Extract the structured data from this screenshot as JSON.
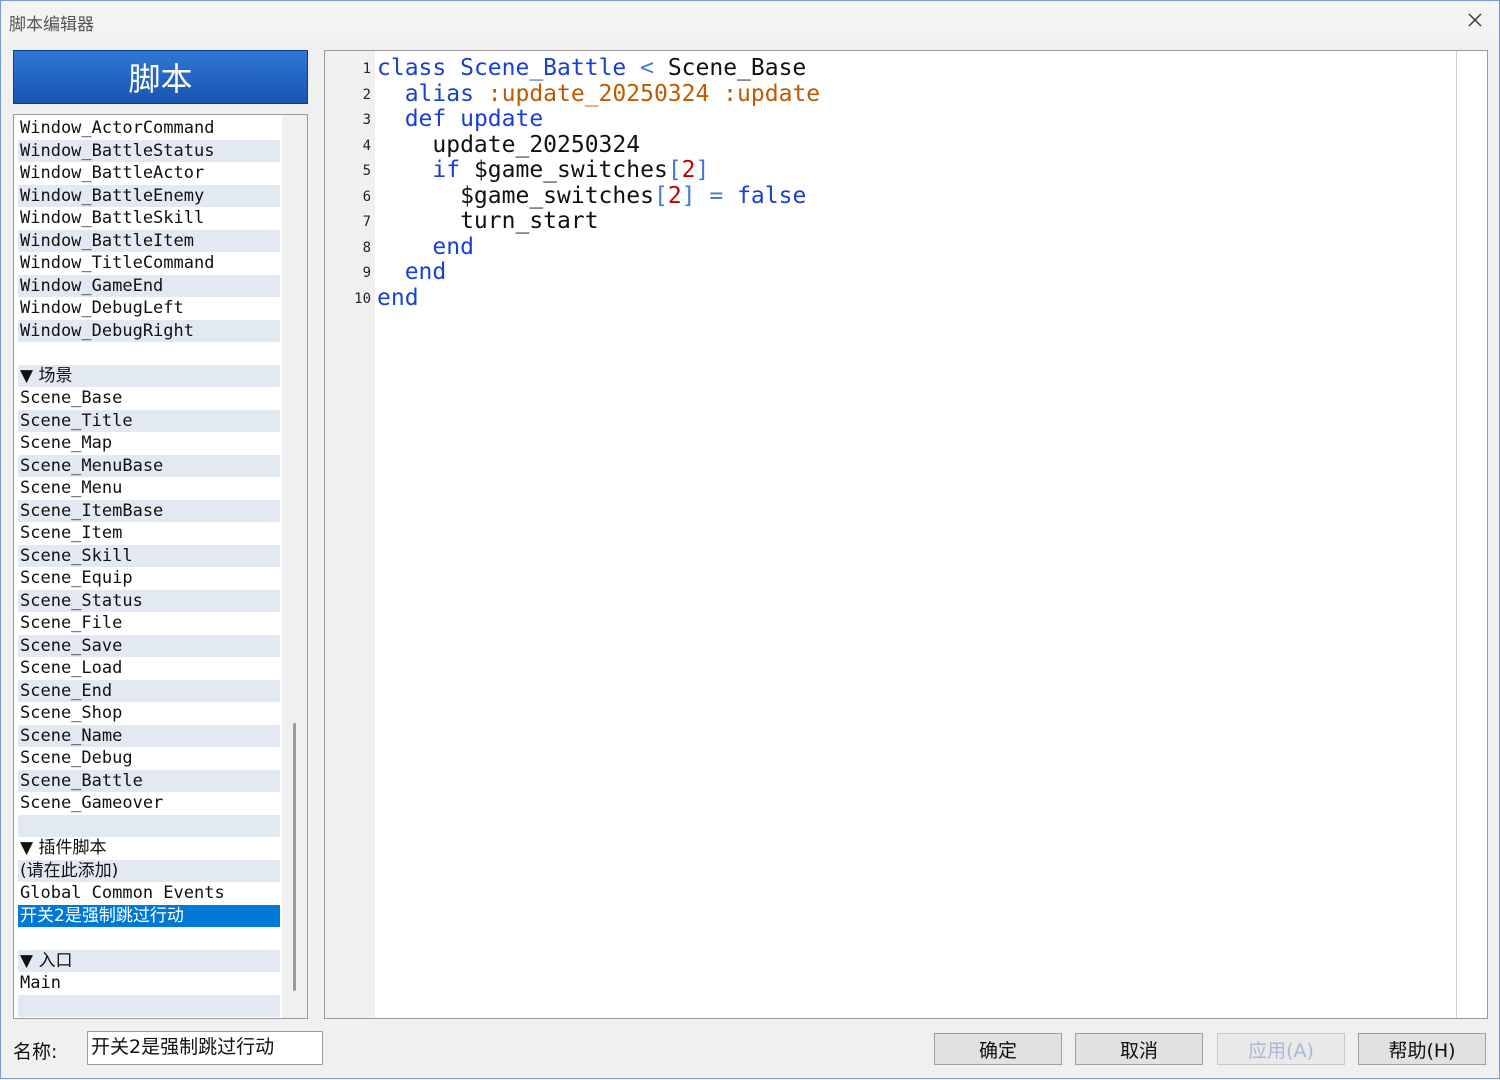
{
  "window": {
    "title": "脚本编辑器"
  },
  "sidebar": {
    "header": "脚本",
    "items": [
      {
        "label": "Window_ActorCommand"
      },
      {
        "label": "Window_BattleStatus"
      },
      {
        "label": "Window_BattleActor"
      },
      {
        "label": "Window_BattleEnemy"
      },
      {
        "label": "Window_BattleSkill"
      },
      {
        "label": "Window_BattleItem"
      },
      {
        "label": "Window_TitleCommand"
      },
      {
        "label": "Window_GameEnd"
      },
      {
        "label": "Window_DebugLeft"
      },
      {
        "label": "Window_DebugRight"
      },
      {
        "label": ""
      },
      {
        "label": "▼ 场景",
        "category": true
      },
      {
        "label": "Scene_Base"
      },
      {
        "label": "Scene_Title"
      },
      {
        "label": "Scene_Map"
      },
      {
        "label": "Scene_MenuBase"
      },
      {
        "label": "Scene_Menu"
      },
      {
        "label": "Scene_ItemBase"
      },
      {
        "label": "Scene_Item"
      },
      {
        "label": "Scene_Skill"
      },
      {
        "label": "Scene_Equip"
      },
      {
        "label": "Scene_Status"
      },
      {
        "label": "Scene_File"
      },
      {
        "label": "Scene_Save"
      },
      {
        "label": "Scene_Load"
      },
      {
        "label": "Scene_End"
      },
      {
        "label": "Scene_Shop"
      },
      {
        "label": "Scene_Name"
      },
      {
        "label": "Scene_Debug"
      },
      {
        "label": "Scene_Battle"
      },
      {
        "label": "Scene_Gameover"
      },
      {
        "label": ""
      },
      {
        "label": "▼ 插件脚本",
        "category": true
      },
      {
        "label": "(请在此添加)",
        "category": true
      },
      {
        "label": "Global Common Events"
      },
      {
        "label": "开关2是强制跳过行动",
        "selected": true,
        "category": true
      },
      {
        "label": ""
      },
      {
        "label": "▼ 入口",
        "category": true
      },
      {
        "label": "Main"
      },
      {
        "label": ""
      }
    ]
  },
  "editor": {
    "lines": [
      [
        {
          "t": "class ",
          "c": "kw"
        },
        {
          "t": "Scene_Battle ",
          "c": "kw"
        },
        {
          "t": "< ",
          "c": "op"
        },
        {
          "t": "Scene_Base",
          "c": ""
        }
      ],
      [
        {
          "t": "  alias ",
          "c": "kw"
        },
        {
          "t": ":update_20250324 :update",
          "c": "sym"
        }
      ],
      [
        {
          "t": "  def ",
          "c": "kw"
        },
        {
          "t": "update",
          "c": "kw"
        }
      ],
      [
        {
          "t": "    update_20250324",
          "c": ""
        }
      ],
      [
        {
          "t": "    if ",
          "c": "kw"
        },
        {
          "t": "$game_switches",
          "c": ""
        },
        {
          "t": "[",
          "c": "op"
        },
        {
          "t": "2",
          "c": "num"
        },
        {
          "t": "]",
          "c": "op"
        }
      ],
      [
        {
          "t": "      $game_switches",
          "c": ""
        },
        {
          "t": "[",
          "c": "op"
        },
        {
          "t": "2",
          "c": "num"
        },
        {
          "t": "]",
          "c": "op"
        },
        {
          "t": " = ",
          "c": "op"
        },
        {
          "t": "false",
          "c": "kw"
        }
      ],
      [
        {
          "t": "      turn_start",
          "c": ""
        }
      ],
      [
        {
          "t": "    end",
          "c": "kw"
        }
      ],
      [
        {
          "t": "  end",
          "c": "kw"
        }
      ],
      [
        {
          "t": "end",
          "c": "kw"
        }
      ]
    ]
  },
  "footer": {
    "name_label": "名称:",
    "name_value": "开关2是强制跳过行动",
    "ok": "确定",
    "cancel": "取消",
    "apply": "应用(A)",
    "help": "帮助(H)"
  }
}
